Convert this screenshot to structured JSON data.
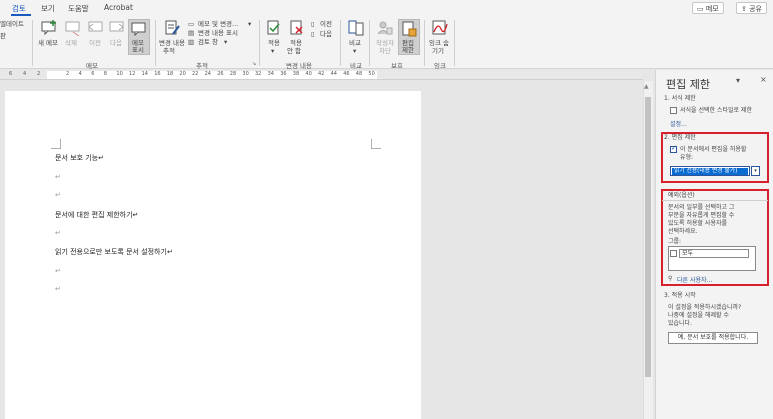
{
  "tabs": [
    "검토",
    "보기",
    "도움말",
    "Acrobat"
  ],
  "top_buttons": {
    "memo": "메모",
    "share": "공유"
  },
  "ribbon": {
    "left_partial": [
      "엘데이트",
      "판"
    ],
    "memo_group": {
      "buttons": [
        "새 메모",
        "삭제",
        "이전",
        "다음",
        "메모",
        "표시"
      ],
      "label": "메모"
    },
    "tracking_group": {
      "track_changes": [
        "변경 내용",
        "추적"
      ],
      "items": [
        "메모 및 변경...",
        "변경 내용 표시",
        "검토 창"
      ],
      "label": "추적"
    },
    "changes_group": {
      "accept": [
        "적용",
        "▾"
      ],
      "reject": [
        "적용",
        "안 함"
      ],
      "prev": "이전",
      "next": "다음",
      "label": "변경 내용"
    },
    "compare_group": {
      "button": [
        "비교",
        "▾"
      ],
      "label": "비교"
    },
    "protect_group": {
      "block_authors": [
        "작성자",
        "차단"
      ],
      "restrict_editing": [
        "편집",
        "제한"
      ],
      "label": "보호"
    },
    "ink_group": {
      "button": [
        "잉크 숨",
        "기기"
      ],
      "label": "잉크"
    }
  },
  "ruler_numbers": [
    "6",
    "4",
    "2",
    "2",
    "4",
    "6",
    "8",
    "10",
    "12",
    "14",
    "16",
    "18",
    "20",
    "22",
    "24",
    "26",
    "28",
    "30",
    "32",
    "34",
    "36",
    "38",
    "40",
    "42",
    "44",
    "46",
    "48",
    "50"
  ],
  "document": {
    "lines": [
      "문서 보호 기능↵",
      "↵",
      "↵",
      "문서에 대한 편집 제한하기↵",
      "↵",
      "읽기 전용으로만 보도록 문서 설정하기↵",
      "↵",
      "↵"
    ]
  },
  "pane": {
    "title": "편집 제한",
    "section1": {
      "heading": "1. 서식 제한",
      "checkbox": "서식을 선택한 스타일로 제한",
      "link": "설정..."
    },
    "section2": {
      "heading": "2. 편집 제한",
      "checkbox_line1": "이 문서에서 편집을 허용할",
      "checkbox_line2": "유형:",
      "dropdown_value": "읽기 전용(내용 변경 불가)"
    },
    "exceptions": {
      "heading": "예외(옵션)",
      "desc": [
        "문서의 일부를 선택하고 그",
        "부분을 자유롭게 편집할 수",
        "있도록 허용할 사용자를",
        "선택하세요."
      ],
      "groups_label": "그룹:",
      "everyone": "모두",
      "more_users": "다른 사용자..."
    },
    "section3": {
      "heading": "3. 적용 시작",
      "desc": [
        "이 설정을 적용하시겠습니까?",
        "나중에 설정을 해제할 수",
        "있습니다."
      ],
      "button": "예, 문서 보호를 적용합니다."
    }
  }
}
